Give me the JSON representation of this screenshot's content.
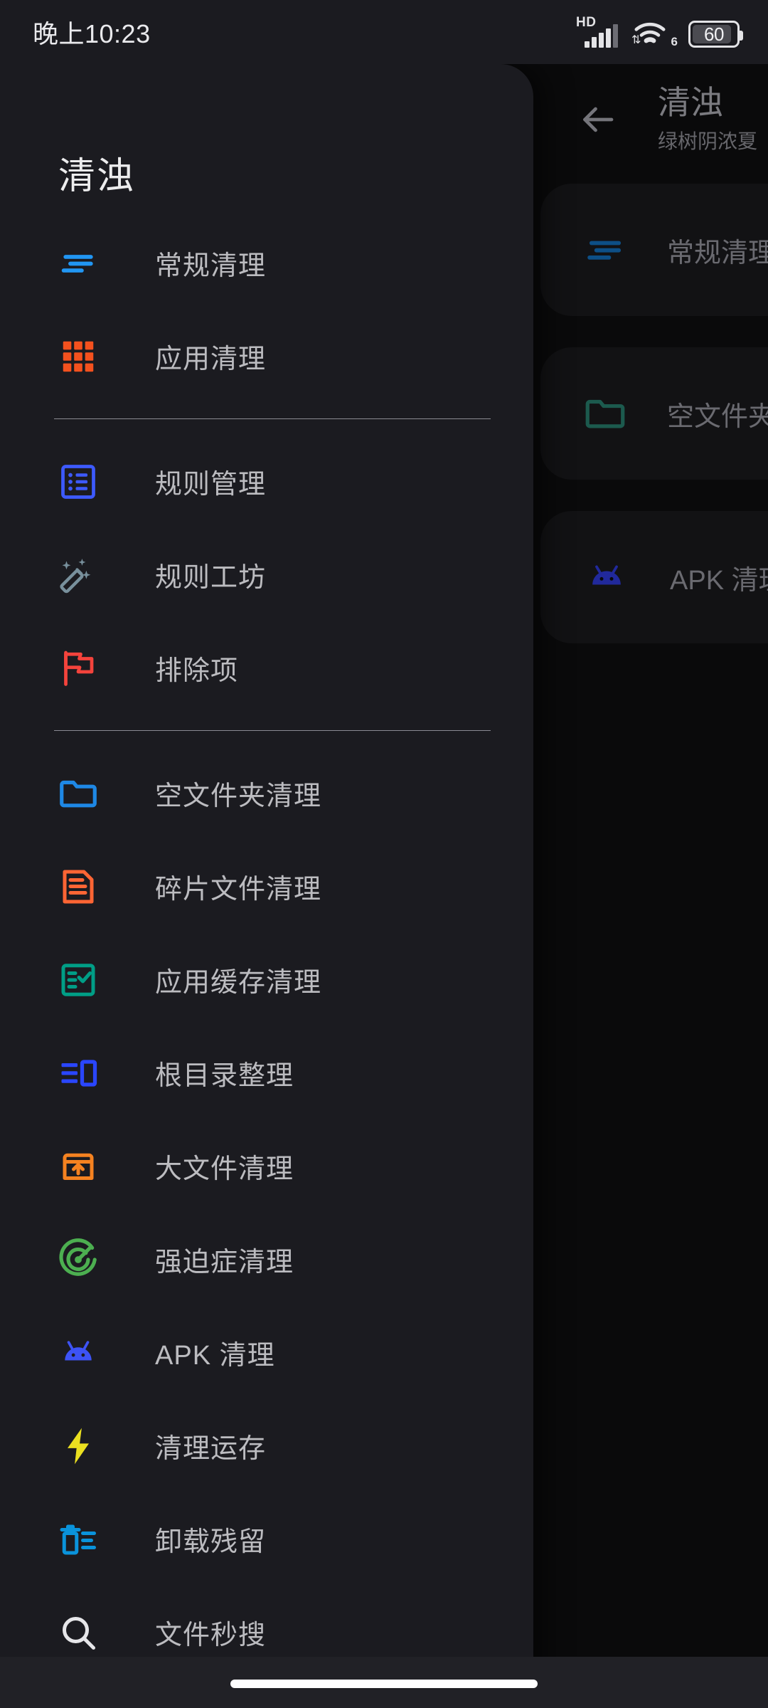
{
  "statusbar": {
    "time": "晚上10:23",
    "network_type": "HD",
    "wifi_generation": "6",
    "battery_percent": "60",
    "icons": [
      "hd-signal-icon",
      "wifi-icon",
      "battery-icon"
    ]
  },
  "drawer": {
    "title": "清浊",
    "groups": [
      {
        "items": [
          {
            "label": "常规清理",
            "icon": "lines-align-icon",
            "color": "#2196f3"
          },
          {
            "label": "应用清理",
            "icon": "app-grid-icon",
            "color": "#f4511e"
          }
        ]
      },
      {
        "items": [
          {
            "label": "规则管理",
            "icon": "rules-list-icon",
            "color": "#3d5afe"
          },
          {
            "label": "规则工坊",
            "icon": "magic-wand-icon",
            "color": "#78909c"
          },
          {
            "label": "排除项",
            "icon": "flag-icon",
            "color": "#f4433c"
          }
        ]
      },
      {
        "items": [
          {
            "label": "空文件夹清理",
            "icon": "folder-icon",
            "color": "#1e88e5"
          },
          {
            "label": "碎片文件清理",
            "icon": "document-icon",
            "color": "#ff6534"
          },
          {
            "label": "应用缓存清理",
            "icon": "checklist-icon",
            "color": "#009e86"
          },
          {
            "label": "根目录整理",
            "icon": "root-directory-icon",
            "color": "#2a46ff"
          },
          {
            "label": "大文件清理",
            "icon": "box-upload-icon",
            "color": "#f58220"
          },
          {
            "label": "强迫症清理",
            "icon": "radar-icon",
            "color": "#4caf50"
          },
          {
            "label": "APK 清理",
            "icon": "android-icon",
            "color": "#3d53f5"
          },
          {
            "label": "清理运存",
            "icon": "lightning-icon",
            "color": "#ebe020"
          },
          {
            "label": "卸载残留",
            "icon": "trash-lines-icon",
            "color": "#0a93db"
          },
          {
            "label": "文件秒搜",
            "icon": "search-icon",
            "color": "#e6e6e9"
          }
        ]
      }
    ]
  },
  "background_page": {
    "back_icon": "arrow-left-icon",
    "title": "清浊",
    "subtitle": "绿树阴浓夏",
    "cards": [
      {
        "label": "常规清理",
        "icon": "lines-align-icon",
        "color": "#0d4f86"
      },
      {
        "label": "空文件夹",
        "icon": "folder-icon",
        "color": "#1c5a4e"
      },
      {
        "label": "APK 清理",
        "icon": "android-icon",
        "color": "#21299c"
      }
    ]
  },
  "navigation": {
    "home_indicator": "home-indicator"
  }
}
